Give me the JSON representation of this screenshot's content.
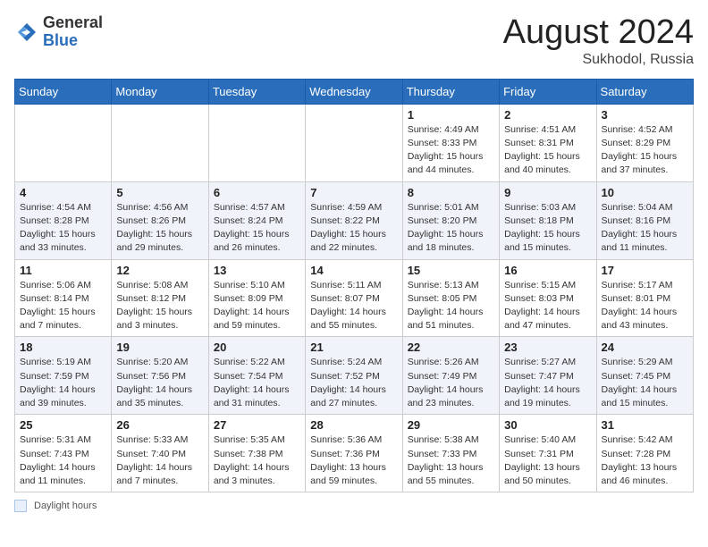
{
  "logo": {
    "general": "General",
    "blue": "Blue"
  },
  "header": {
    "month": "August 2024",
    "location": "Sukhodol, Russia"
  },
  "days_of_week": [
    "Sunday",
    "Monday",
    "Tuesday",
    "Wednesday",
    "Thursday",
    "Friday",
    "Saturday"
  ],
  "footer": {
    "label": "Daylight hours"
  },
  "weeks": [
    [
      {
        "day": "",
        "info": ""
      },
      {
        "day": "",
        "info": ""
      },
      {
        "day": "",
        "info": ""
      },
      {
        "day": "",
        "info": ""
      },
      {
        "day": "1",
        "info": "Sunrise: 4:49 AM\nSunset: 8:33 PM\nDaylight: 15 hours\nand 44 minutes."
      },
      {
        "day": "2",
        "info": "Sunrise: 4:51 AM\nSunset: 8:31 PM\nDaylight: 15 hours\nand 40 minutes."
      },
      {
        "day": "3",
        "info": "Sunrise: 4:52 AM\nSunset: 8:29 PM\nDaylight: 15 hours\nand 37 minutes."
      }
    ],
    [
      {
        "day": "4",
        "info": "Sunrise: 4:54 AM\nSunset: 8:28 PM\nDaylight: 15 hours\nand 33 minutes."
      },
      {
        "day": "5",
        "info": "Sunrise: 4:56 AM\nSunset: 8:26 PM\nDaylight: 15 hours\nand 29 minutes."
      },
      {
        "day": "6",
        "info": "Sunrise: 4:57 AM\nSunset: 8:24 PM\nDaylight: 15 hours\nand 26 minutes."
      },
      {
        "day": "7",
        "info": "Sunrise: 4:59 AM\nSunset: 8:22 PM\nDaylight: 15 hours\nand 22 minutes."
      },
      {
        "day": "8",
        "info": "Sunrise: 5:01 AM\nSunset: 8:20 PM\nDaylight: 15 hours\nand 18 minutes."
      },
      {
        "day": "9",
        "info": "Sunrise: 5:03 AM\nSunset: 8:18 PM\nDaylight: 15 hours\nand 15 minutes."
      },
      {
        "day": "10",
        "info": "Sunrise: 5:04 AM\nSunset: 8:16 PM\nDaylight: 15 hours\nand 11 minutes."
      }
    ],
    [
      {
        "day": "11",
        "info": "Sunrise: 5:06 AM\nSunset: 8:14 PM\nDaylight: 15 hours\nand 7 minutes."
      },
      {
        "day": "12",
        "info": "Sunrise: 5:08 AM\nSunset: 8:12 PM\nDaylight: 15 hours\nand 3 minutes."
      },
      {
        "day": "13",
        "info": "Sunrise: 5:10 AM\nSunset: 8:09 PM\nDaylight: 14 hours\nand 59 minutes."
      },
      {
        "day": "14",
        "info": "Sunrise: 5:11 AM\nSunset: 8:07 PM\nDaylight: 14 hours\nand 55 minutes."
      },
      {
        "day": "15",
        "info": "Sunrise: 5:13 AM\nSunset: 8:05 PM\nDaylight: 14 hours\nand 51 minutes."
      },
      {
        "day": "16",
        "info": "Sunrise: 5:15 AM\nSunset: 8:03 PM\nDaylight: 14 hours\nand 47 minutes."
      },
      {
        "day": "17",
        "info": "Sunrise: 5:17 AM\nSunset: 8:01 PM\nDaylight: 14 hours\nand 43 minutes."
      }
    ],
    [
      {
        "day": "18",
        "info": "Sunrise: 5:19 AM\nSunset: 7:59 PM\nDaylight: 14 hours\nand 39 minutes."
      },
      {
        "day": "19",
        "info": "Sunrise: 5:20 AM\nSunset: 7:56 PM\nDaylight: 14 hours\nand 35 minutes."
      },
      {
        "day": "20",
        "info": "Sunrise: 5:22 AM\nSunset: 7:54 PM\nDaylight: 14 hours\nand 31 minutes."
      },
      {
        "day": "21",
        "info": "Sunrise: 5:24 AM\nSunset: 7:52 PM\nDaylight: 14 hours\nand 27 minutes."
      },
      {
        "day": "22",
        "info": "Sunrise: 5:26 AM\nSunset: 7:49 PM\nDaylight: 14 hours\nand 23 minutes."
      },
      {
        "day": "23",
        "info": "Sunrise: 5:27 AM\nSunset: 7:47 PM\nDaylight: 14 hours\nand 19 minutes."
      },
      {
        "day": "24",
        "info": "Sunrise: 5:29 AM\nSunset: 7:45 PM\nDaylight: 14 hours\nand 15 minutes."
      }
    ],
    [
      {
        "day": "25",
        "info": "Sunrise: 5:31 AM\nSunset: 7:43 PM\nDaylight: 14 hours\nand 11 minutes."
      },
      {
        "day": "26",
        "info": "Sunrise: 5:33 AM\nSunset: 7:40 PM\nDaylight: 14 hours\nand 7 minutes."
      },
      {
        "day": "27",
        "info": "Sunrise: 5:35 AM\nSunset: 7:38 PM\nDaylight: 14 hours\nand 3 minutes."
      },
      {
        "day": "28",
        "info": "Sunrise: 5:36 AM\nSunset: 7:36 PM\nDaylight: 13 hours\nand 59 minutes."
      },
      {
        "day": "29",
        "info": "Sunrise: 5:38 AM\nSunset: 7:33 PM\nDaylight: 13 hours\nand 55 minutes."
      },
      {
        "day": "30",
        "info": "Sunrise: 5:40 AM\nSunset: 7:31 PM\nDaylight: 13 hours\nand 50 minutes."
      },
      {
        "day": "31",
        "info": "Sunrise: 5:42 AM\nSunset: 7:28 PM\nDaylight: 13 hours\nand 46 minutes."
      }
    ]
  ]
}
